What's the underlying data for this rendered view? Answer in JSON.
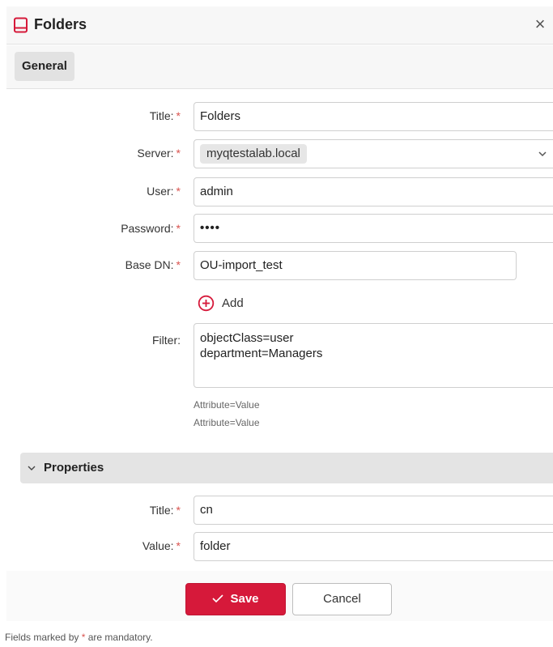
{
  "dialog": {
    "title": "Folders",
    "close_label": "×",
    "tabs": [
      {
        "label": "General",
        "active": true
      }
    ]
  },
  "form": {
    "required_marker": "*",
    "title": {
      "label": "Title:",
      "value": "Folders"
    },
    "server": {
      "label": "Server:",
      "value": "myqtestalab.local"
    },
    "user": {
      "label": "User:",
      "value": "admin"
    },
    "password": {
      "label": "Password:",
      "value": "••••"
    },
    "base_dn": {
      "label": "Base DN:",
      "value": "OU-import_test"
    },
    "add_label": "Add",
    "filter": {
      "label": "Filter:",
      "lines": [
        "objectClass=user",
        "department=Managers"
      ],
      "hints": [
        "Attribute=Value",
        "Attribute=Value"
      ]
    }
  },
  "properties": {
    "section_title": "Properties",
    "title": {
      "label": "Title:",
      "value": "cn"
    },
    "value": {
      "label": "Value:",
      "value": "folder"
    }
  },
  "actions": {
    "save_label": "Save",
    "cancel_label": "Cancel"
  },
  "footer": {
    "note_prefix": "Fields marked by",
    "note_star": "*",
    "note_suffix": "are mandatory."
  },
  "colors": {
    "accent": "#d6193a",
    "required": "#d9534f",
    "header_bg": "#f7f7f7"
  },
  "icons": {
    "title": "book-icon",
    "close": "close-icon",
    "server": "chevron-down-icon",
    "add": "plus-circle-icon",
    "section": "chevron-down-icon",
    "save": "check-icon"
  }
}
